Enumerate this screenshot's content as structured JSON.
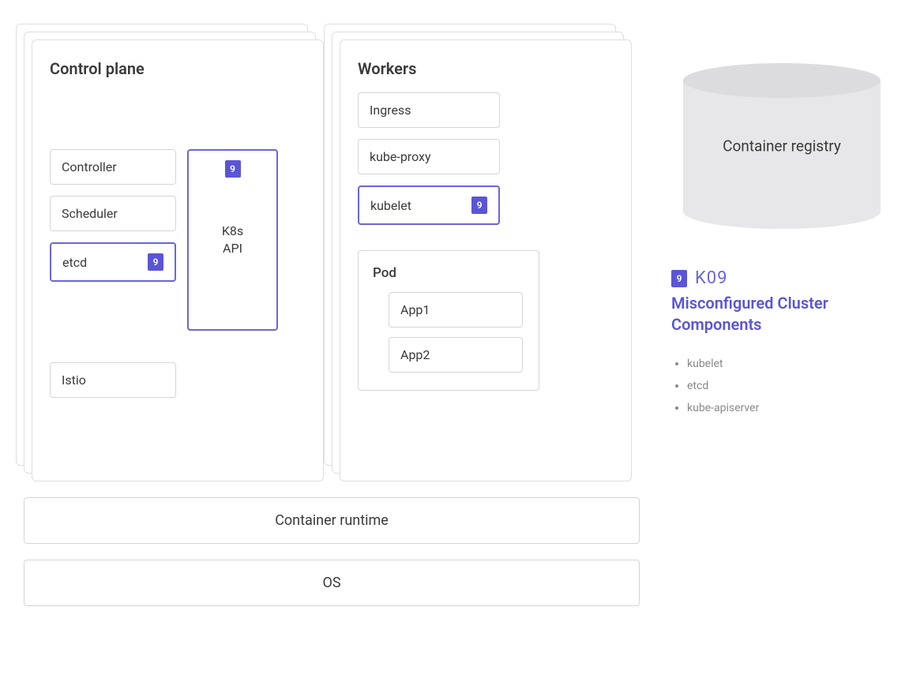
{
  "diagram": {
    "controlPlane": {
      "title": "Control plane",
      "items": {
        "controller": "Controller",
        "scheduler": "Scheduler",
        "etcd": "etcd",
        "api": "K8s\nAPI",
        "istio": "Istio"
      },
      "badges": {
        "etcd": "9",
        "api": "9"
      }
    },
    "workers": {
      "title": "Workers",
      "items": {
        "ingress": "Ingress",
        "kubeproxy": "kube-proxy",
        "kubelet": "kubelet"
      },
      "badges": {
        "kubelet": "9"
      },
      "pod": {
        "title": "Pod",
        "apps": {
          "app1": "App1",
          "app2": "App2"
        }
      }
    },
    "runtime": "Container runtime",
    "os": "OS",
    "registry": "Container registry"
  },
  "info": {
    "badge": "9",
    "code": "K09",
    "title": "Misconfigured Cluster Components",
    "bullets": [
      "kubelet",
      "etcd",
      "kube-apiserver"
    ]
  },
  "colors": {
    "accent": "#5a55d6",
    "border": "#d5d5d5",
    "text": "#3a3a3a"
  }
}
